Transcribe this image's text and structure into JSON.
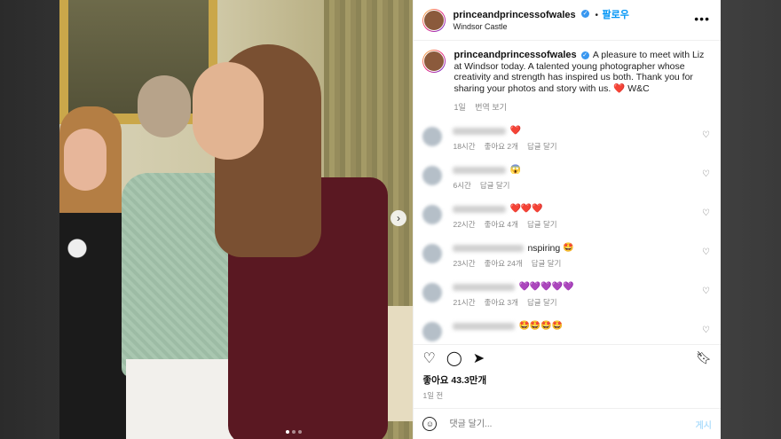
{
  "header": {
    "username": "princeandprincessofwales",
    "verified_icon": "verified-badge-icon",
    "separator": "•",
    "follow_label": "팔로우",
    "location": "Windsor Castle",
    "more_icon": "more-options-icon"
  },
  "caption": {
    "username": "princeandprincessofwales",
    "text": "A pleasure to meet with Liz at Windsor today. A talented young photographer whose creativity and strength has inspired us both. Thank you for sharing your photos and story with us.",
    "heart": "❤️",
    "signoff": "W&C",
    "time": "1일",
    "translate": "번역 보기"
  },
  "comments": [
    {
      "text": "",
      "emoji": "❤️",
      "time": "18시간",
      "likes": "좋아요 2개",
      "reply": "답글 달기"
    },
    {
      "text": "",
      "emoji": "😱",
      "time": "6시간",
      "likes": "",
      "reply": "답글 달기"
    },
    {
      "text": "",
      "emoji": "❤️❤️❤️",
      "time": "22시간",
      "likes": "좋아요 4개",
      "reply": "답글 달기"
    },
    {
      "text": "nspiring",
      "emoji": "🤩",
      "time": "23시간",
      "likes": "좋아요 24개",
      "reply": "답글 달기"
    },
    {
      "text": "",
      "emoji": "💜💜💜💜💜",
      "time": "21시간",
      "likes": "좋아요 3개",
      "reply": "답글 달기"
    },
    {
      "text": "",
      "emoji": "🤩🤩🤩🤩",
      "time": "",
      "likes": "",
      "reply": ""
    }
  ],
  "actions": {
    "like_icon": "heart-icon",
    "comment_icon": "comment-icon",
    "share_icon": "share-icon",
    "save_icon": "bookmark-icon"
  },
  "likes_label": "좋아요 43.3만개",
  "date_label": "1일 전",
  "comment_box": {
    "placeholder": "댓글 달기...",
    "post_label": "게시"
  },
  "colors": {
    "accent": "#0095f6",
    "heart": "#e0245e",
    "verified": "#3897f0"
  }
}
